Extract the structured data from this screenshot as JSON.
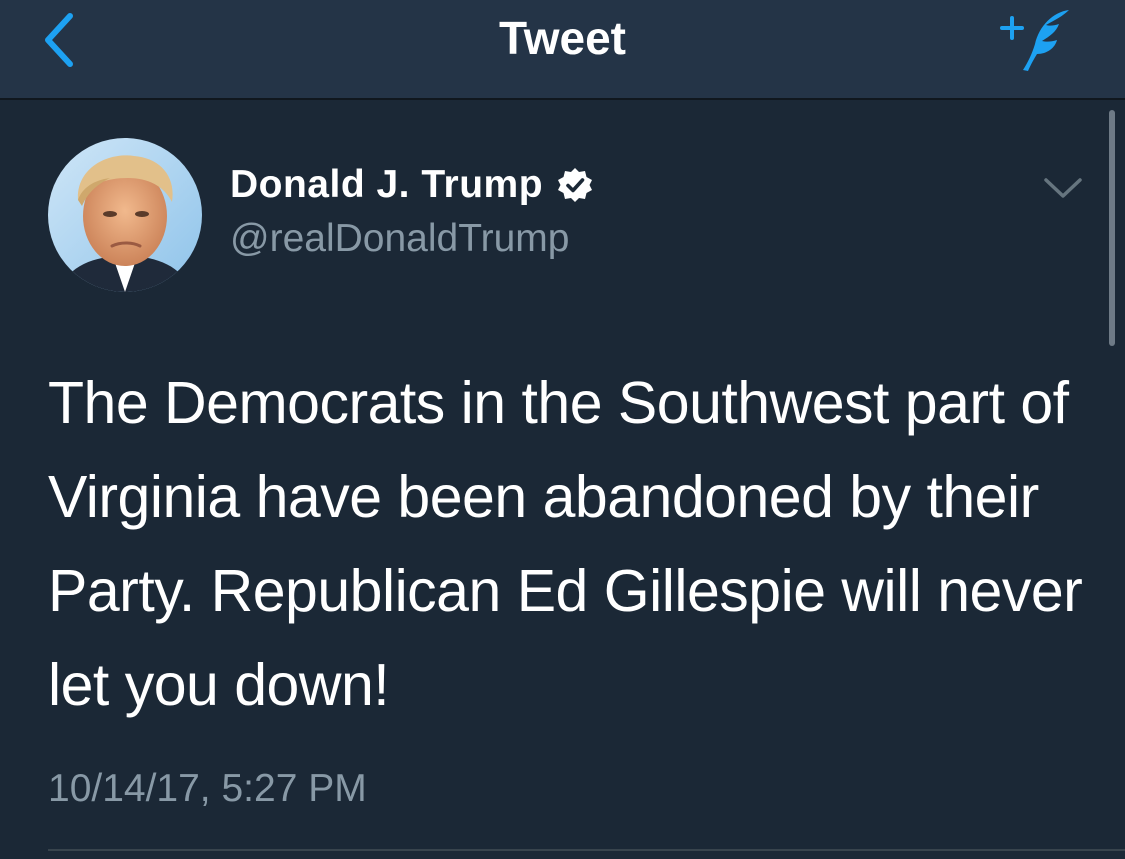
{
  "navbar": {
    "title": "Tweet",
    "back_icon": "chevron-left-icon",
    "compose_icon": "compose-feather-icon",
    "accent_color": "#1da1f2",
    "background_color": "#243447"
  },
  "tweet": {
    "author": {
      "display_name": "Donald J. Trump",
      "handle": "@realDonaldTrump",
      "verified": true,
      "avatar_icon": "profile-photo"
    },
    "text": "The Democrats in the Southwest part of Virginia have been abandoned by their Party. Republican Ed Gillespie will never let you down!",
    "timestamp": "10/14/17, 5:27 PM",
    "menu_icon": "chevron-down-icon"
  },
  "theme": {
    "background": "#1b2836",
    "primary_text": "#ffffff",
    "secondary_text": "#8899a6"
  }
}
